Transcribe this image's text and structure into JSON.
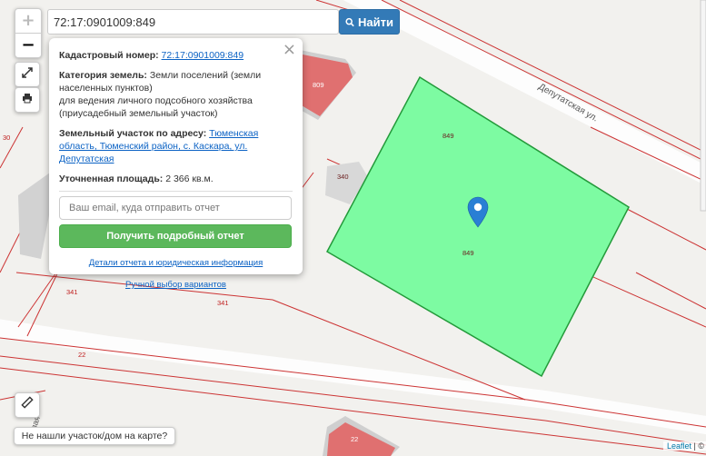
{
  "search": {
    "value": "72:17:0901009:849",
    "button_label": "Найти"
  },
  "zoom": {
    "in_label": "+",
    "out_label": "−"
  },
  "map": {
    "street_label": "Депутатская ул.",
    "road_label_fragment": "рвая",
    "parcel_main_label": "849",
    "parcel_main_label_top": "849",
    "building_labels": [
      "809",
      "340",
      "22"
    ],
    "parcel_labels": [
      "341",
      "341",
      "22",
      "30"
    ],
    "parcel_fill_color": "#7dfba2",
    "parcel_stroke_color": "#239a3a",
    "boundary_color": "#cc3333",
    "building_color": "#e07070",
    "marker_color": "#2a7fd4"
  },
  "popup": {
    "cadastral_label": "Кадастровый номер:",
    "cadastral_value": "72:17:0901009:849",
    "category_label": "Категория земель:",
    "category_value": "Земли поселений (земли населенных пунктов)",
    "use_value": "для ведения личного подсобного хозяйства (приусадебный земельный участок)",
    "address_label": "Земельный участок по адресу:",
    "address_value": "Тюменская область, Тюменский район, с. Каскара, ул. Депутатская",
    "area_label": "Уточненная площадь:",
    "area_value": "2 366 кв.м.",
    "email_placeholder": "Ваш email, куда отправить отчет",
    "report_button": "Получить подробный отчет",
    "details_link": "Детали отчета и юридическая информация",
    "manual_link": "Ручной выбор вариантов",
    "close_glyph": "×"
  },
  "not_found_label": "Не нашли участок/дом на карте?",
  "attribution": {
    "leaflet": "Leaflet",
    "rest": "| ©"
  }
}
